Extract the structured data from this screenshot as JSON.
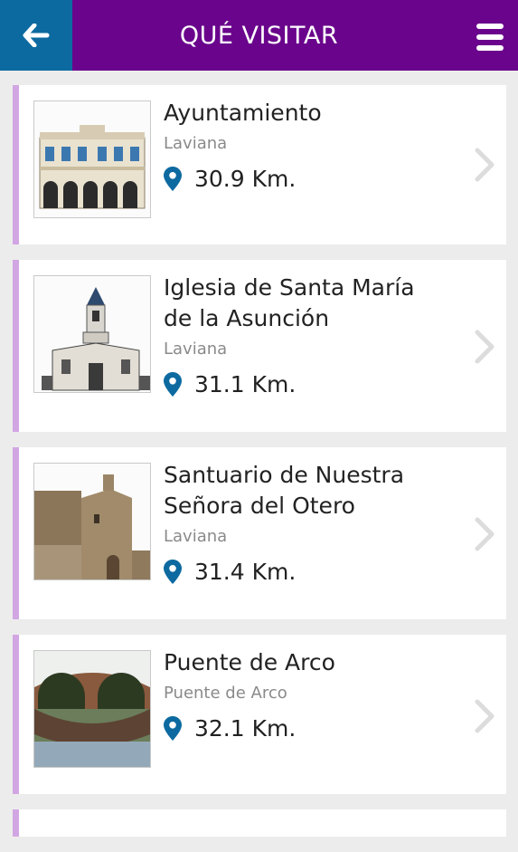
{
  "header": {
    "title": "QUÉ VISITAR",
    "accent_color": "#6a048c",
    "back_color": "#0d6aa0",
    "back_icon": "arrow-left-icon",
    "menu_icon": "hamburger-menu-icon"
  },
  "places": [
    {
      "title_lines": [
        "Ayuntamiento"
      ],
      "location": "Laviana",
      "distance": "30.9 Km."
    },
    {
      "title_lines": [
        "Iglesia de Santa María",
        "de la Asunción"
      ],
      "location": "Laviana",
      "distance": "31.1 Km."
    },
    {
      "title_lines": [
        "Santuario de Nuestra",
        "Señora del Otero"
      ],
      "location": "Laviana",
      "distance": "31.4 Km."
    },
    {
      "title_lines": [
        "Puente de Arco"
      ],
      "location": "Puente de Arco",
      "distance": "32.1 Km."
    }
  ],
  "icons": {
    "pin": "location-pin-icon",
    "chevron": "chevron-right-icon"
  }
}
